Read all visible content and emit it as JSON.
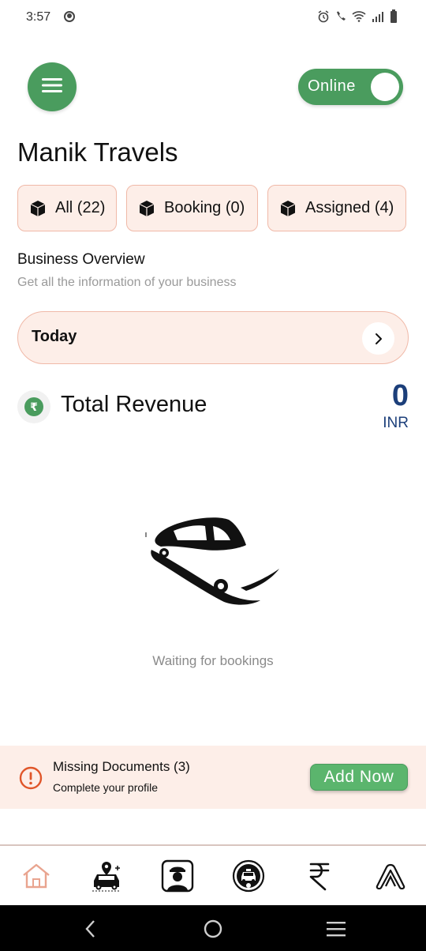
{
  "status_bar": {
    "time": "3:57"
  },
  "header": {
    "online_label": "Online"
  },
  "page_title": "Manik Travels",
  "filters": [
    {
      "label": "All (22)"
    },
    {
      "label": "Booking (0)"
    },
    {
      "label": "Assigned (4)"
    }
  ],
  "overview": {
    "title": "Business Overview",
    "subtitle": "Get all the information of your business"
  },
  "date_selector": {
    "label": "Today"
  },
  "revenue": {
    "label": "Total Revenue",
    "amount": "0",
    "currency": "INR",
    "icon_symbol": "₹"
  },
  "empty_state": {
    "text": "Waiting for bookings"
  },
  "missing_docs": {
    "title": "Missing Documents (3)",
    "subtitle": "Complete your profile",
    "button_label": "Add Now"
  },
  "bottom_nav": {
    "items": [
      {
        "icon": "home-icon"
      },
      {
        "icon": "car-location-icon"
      },
      {
        "icon": "driver-icon"
      },
      {
        "icon": "taxi-icon"
      },
      {
        "icon": "rupee-icon"
      },
      {
        "icon": "account-icon"
      }
    ]
  },
  "colors": {
    "accent_green": "#4a9c5e",
    "chip_bg": "#fdeee8",
    "chip_border": "#f0b9a8",
    "revenue_blue": "#1c3f7a",
    "warning_orange": "#e0562a"
  }
}
